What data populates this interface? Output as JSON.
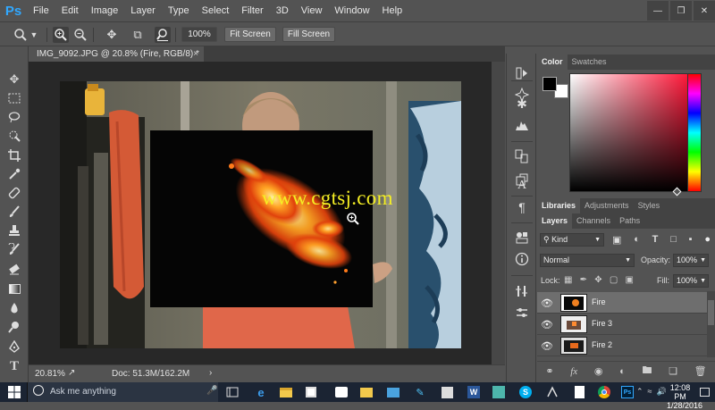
{
  "menu": {
    "logo": "Ps",
    "items": [
      "File",
      "Edit",
      "Image",
      "Layer",
      "Type",
      "Select",
      "Filter",
      "3D",
      "View",
      "Window",
      "Help"
    ]
  },
  "options": {
    "zoom_value": "100%",
    "fit_screen": "Fit Screen",
    "fill_screen": "Fill Screen"
  },
  "document": {
    "tab_title": "IMG_9092.JPG @ 20.8% (Fire, RGB/8) *",
    "watermark": "www.cgtsj.com"
  },
  "status": {
    "zoom": "20.81%",
    "doc": "Doc: 51.3M/162.2M",
    "arrow": "›"
  },
  "color_panel": {
    "tabs": [
      "Color",
      "Swatches"
    ],
    "foreground": "#000000",
    "background": "#ffffff"
  },
  "libraries_panel": {
    "tabs": [
      "Libraries",
      "Adjustments",
      "Styles"
    ]
  },
  "layers_panel": {
    "tabs": [
      "Layers",
      "Channels",
      "Paths"
    ],
    "filter_kind": "Kind",
    "blend_mode": "Normal",
    "opacity_label": "Opacity:",
    "opacity_value": "100%",
    "lock_label": "Lock:",
    "fill_label": "Fill:",
    "fill_value": "100%",
    "fx_label": "fx",
    "layers": [
      {
        "name": "Fire",
        "active": true
      },
      {
        "name": "Fire 3",
        "active": false
      },
      {
        "name": "Fire 2",
        "active": false
      }
    ]
  },
  "taskbar": {
    "search_placeholder": "Ask me anything",
    "time": "12:08 PM",
    "date": "1/28/2016"
  },
  "colors": {
    "ps_blue": "#31a8ff",
    "watermark": "#f5ef24",
    "spectrum_hue": "#ff0025"
  }
}
